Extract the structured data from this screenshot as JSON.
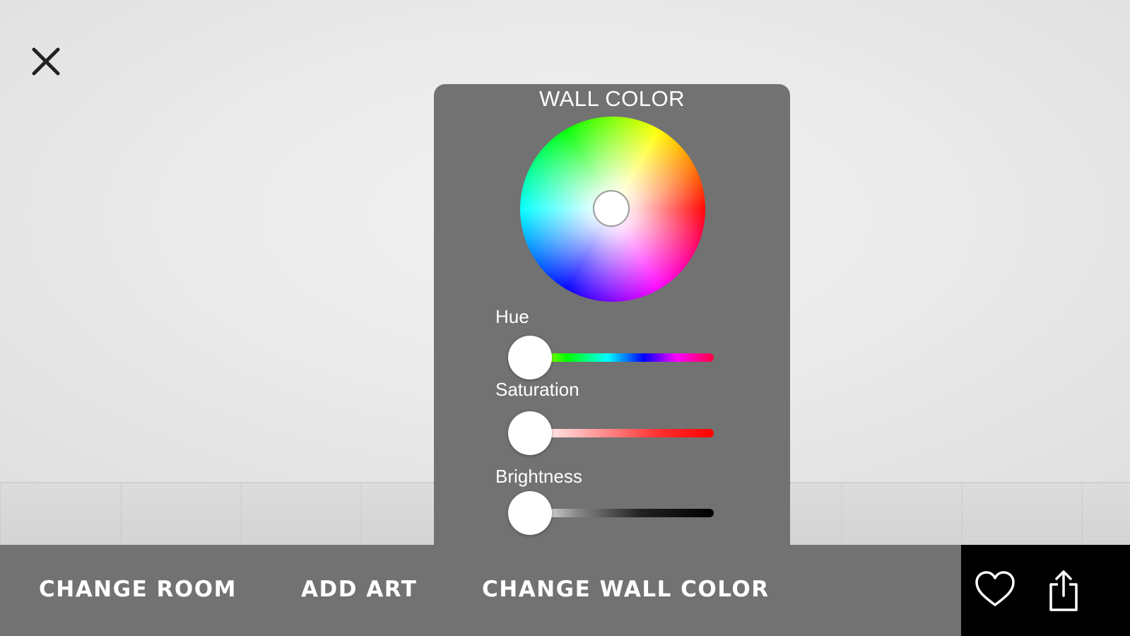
{
  "close_icon": "close-icon",
  "wall_color_panel": {
    "title": "WALL COLOR",
    "sliders": {
      "hue": {
        "label": "Hue",
        "value_fraction": 0.0
      },
      "saturation": {
        "label": "Saturation",
        "value_fraction": 0.0
      },
      "brightness": {
        "label": "Brightness",
        "value_fraction": 0.0
      }
    },
    "selected_color": "#ffffff"
  },
  "bottom_bar": {
    "change_room_label": "CHANGE ROOM",
    "add_art_label": "ADD ART",
    "change_wall_color_label": "CHANGE WALL COLOR"
  },
  "actions": {
    "favorite_icon": "heart-icon",
    "share_icon": "share-icon"
  },
  "colors": {
    "panel_background": "#727272",
    "action_background": "#000000",
    "text": "#ffffff"
  }
}
